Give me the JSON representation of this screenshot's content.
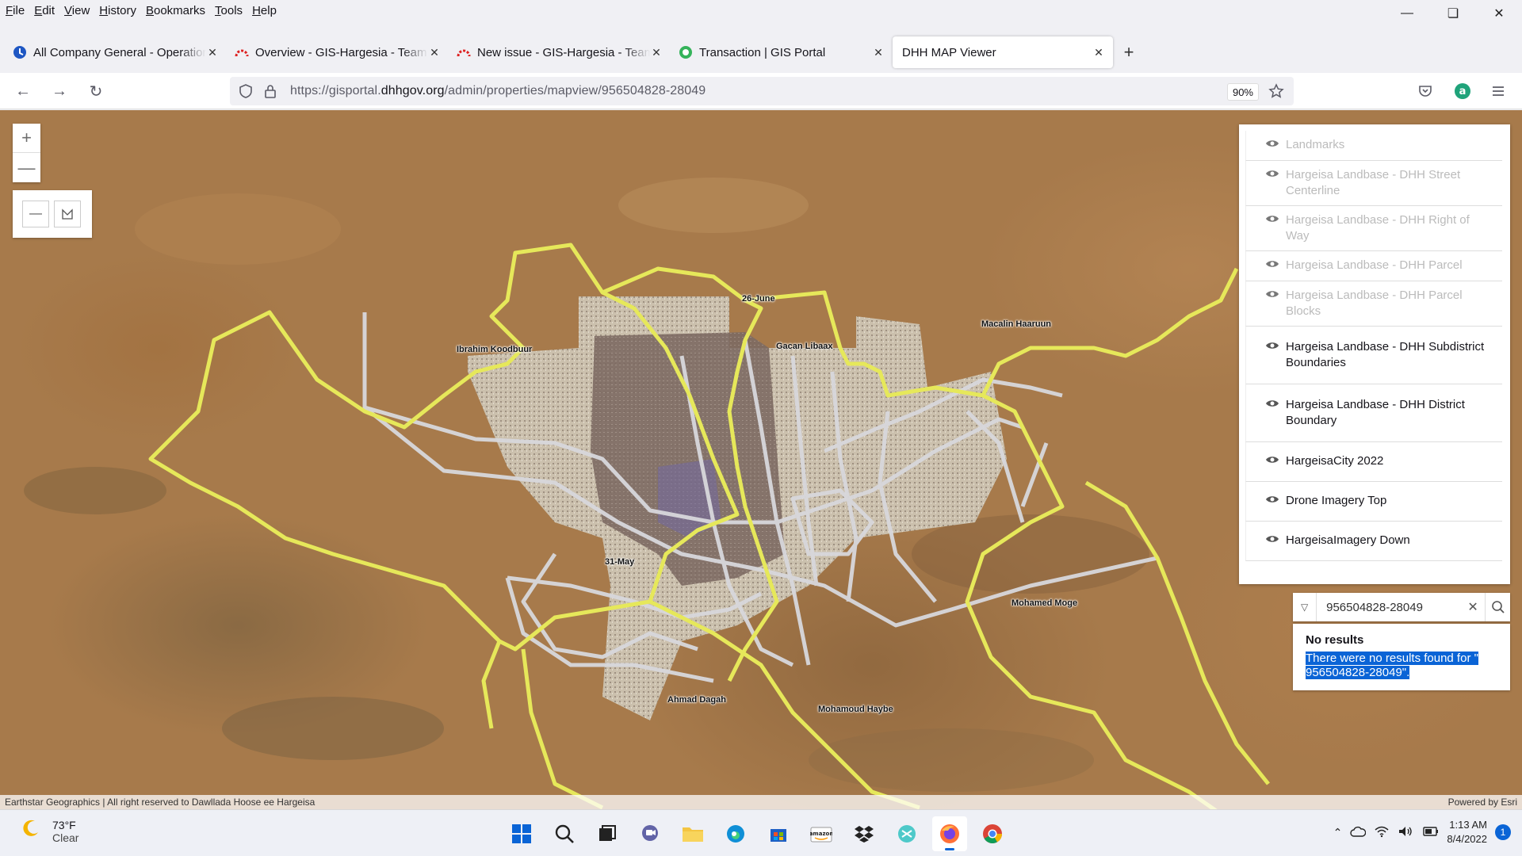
{
  "menubar": {
    "items": [
      {
        "label": "File",
        "u": "F",
        "rest": "ile"
      },
      {
        "label": "Edit",
        "u": "E",
        "rest": "dit"
      },
      {
        "label": "View",
        "u": "V",
        "rest": "iew"
      },
      {
        "label": "History",
        "u": "H",
        "rest": "istory"
      },
      {
        "label": "Bookmarks",
        "u": "B",
        "rest": "ookmarks"
      },
      {
        "label": "Tools",
        "u": "T",
        "rest": "ools"
      },
      {
        "label": "Help",
        "u": "H",
        "rest": "elp"
      }
    ]
  },
  "tabs": [
    {
      "title": "All Company General - Operations",
      "icon": "teams-icon",
      "active": false
    },
    {
      "title": "Overview - GIS-Hargesia - Team",
      "icon": "devops-icon",
      "active": false
    },
    {
      "title": "New issue - GIS-Hargesia - Team",
      "icon": "devops-icon",
      "active": false
    },
    {
      "title": "Transaction | GIS Portal",
      "icon": "portal-icon",
      "active": false
    },
    {
      "title": "DHH MAP Viewer",
      "icon": "",
      "active": true
    }
  ],
  "navbar": {
    "url_prefix": "https://gisportal.",
    "url_domain": "dhhgov.org",
    "url_path": "/admin/properties/mapview/956504828-28049",
    "zoom": "90%"
  },
  "map": {
    "labels": [
      {
        "text": "26-June"
      },
      {
        "text": "Ibrahim Koodbuur"
      },
      {
        "text": "Gacan Libaax"
      },
      {
        "text": "Macalin Haaruun"
      },
      {
        "text": "31-May"
      },
      {
        "text": "Mohamed Moge"
      },
      {
        "text": "Ahmad Dagah"
      },
      {
        "text": "Mohamoud Haybe"
      }
    ],
    "attribution_left": "Earthstar Geographics | All right reserved to Dawllada Hoose ee Hargeisa",
    "attribution_right": "Powered by Esri",
    "boundary_color": "#e6e85a",
    "subdistrict_color": "#d8d8dc"
  },
  "layers": [
    {
      "name": "Landmarks",
      "visible": false
    },
    {
      "name": "Hargeisa Landbase - DHH Street Centerline",
      "visible": false
    },
    {
      "name": "Hargeisa Landbase - DHH Right of Way",
      "visible": false
    },
    {
      "name": "Hargeisa Landbase - DHH Parcel",
      "visible": false
    },
    {
      "name": "Hargeisa Landbase - DHH Parcel Blocks",
      "visible": false
    },
    {
      "name": "Hargeisa Landbase - DHH Subdistrict Boundaries",
      "visible": true
    },
    {
      "name": "Hargeisa Landbase - DHH District Boundary",
      "visible": true
    },
    {
      "name": "HargeisaCity 2022",
      "visible": true
    },
    {
      "name": "Drone Imagery Top",
      "visible": true
    },
    {
      "name": "HargeisaImagery Down",
      "visible": true
    }
  ],
  "search": {
    "value": "956504828-28049",
    "result_title": "No results",
    "result_msg": "There were no results found for \" 956504828-28049\"."
  },
  "taskbar": {
    "temp": "73°F",
    "condition": "Clear",
    "time": "1:13 AM",
    "date": "8/4/2022",
    "notifications": "1"
  }
}
